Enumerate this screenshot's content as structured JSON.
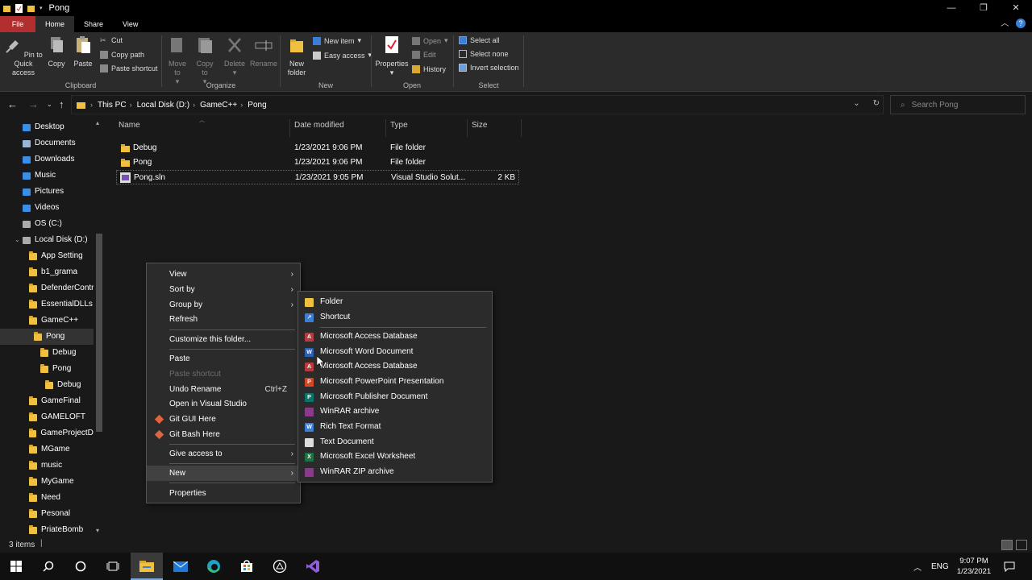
{
  "window": {
    "title": "Pong"
  },
  "tabs": {
    "file": "File",
    "home": "Home",
    "share": "Share",
    "view": "View"
  },
  "ribbon": {
    "clipboard": {
      "label": "Clipboard",
      "pin": "Pin to Quick access",
      "copy": "Copy",
      "paste": "Paste",
      "cut": "Cut",
      "copy_path": "Copy path",
      "paste_shortcut": "Paste shortcut"
    },
    "organize": {
      "label": "Organize",
      "move_to": "Move to",
      "copy_to": "Copy to",
      "delete": "Delete",
      "rename": "Rename"
    },
    "new": {
      "label": "New",
      "new_folder": "New folder",
      "new_item": "New item",
      "easy_access": "Easy access"
    },
    "open": {
      "label": "Open",
      "properties": "Properties",
      "open": "Open",
      "edit": "Edit",
      "history": "History"
    },
    "select": {
      "label": "Select",
      "select_all": "Select all",
      "select_none": "Select none",
      "invert": "Invert selection"
    }
  },
  "address": {
    "crumbs": [
      "This PC",
      "Local Disk (D:)",
      "GameC++",
      "Pong"
    ],
    "search_placeholder": "Search Pong"
  },
  "nav": {
    "items": [
      "Desktop",
      "Documents",
      "Downloads",
      "Music",
      "Pictures",
      "Videos",
      "OS (C:)",
      "Local Disk (D:)",
      "App Setting",
      "b1_grama",
      "DefenderContr",
      "EssentialDLLs",
      "GameC++",
      "Pong",
      "Debug",
      "Pong",
      "Debug",
      "GameFinal",
      "GAMELOFT",
      "GameProjectDc",
      "MGame",
      "music",
      "MyGame",
      "Need",
      "Pesonal",
      "PriateBomb"
    ]
  },
  "files": {
    "headers": {
      "name": "Name",
      "date": "Date modified",
      "type": "Type",
      "size": "Size"
    },
    "rows": [
      {
        "name": "Debug",
        "date": "1/23/2021 9:06 PM",
        "type": "File folder",
        "size": ""
      },
      {
        "name": "Pong",
        "date": "1/23/2021 9:06 PM",
        "type": "File folder",
        "size": ""
      },
      {
        "name": "Pong.sln",
        "date": "1/23/2021 9:05 PM",
        "type": "Visual Studio Solut...",
        "size": "2 KB"
      }
    ]
  },
  "context_menu": {
    "view": "View",
    "sort_by": "Sort by",
    "group_by": "Group by",
    "refresh": "Refresh",
    "customize": "Customize this folder...",
    "paste": "Paste",
    "paste_shortcut": "Paste shortcut",
    "undo_rename": "Undo Rename",
    "undo_shortcut": "Ctrl+Z",
    "open_vs": "Open in Visual Studio",
    "git_gui": "Git GUI Here",
    "git_bash": "Git Bash Here",
    "give_access": "Give access to",
    "new": "New",
    "properties": "Properties"
  },
  "new_submenu": {
    "items": [
      "Folder",
      "Shortcut",
      "Microsoft Access Database",
      "Microsoft Word Document",
      "Microsoft Access Database",
      "Microsoft PowerPoint Presentation",
      "Microsoft Publisher Document",
      "WinRAR archive",
      "Rich Text Format",
      "Text Document",
      "Microsoft Excel Worksheet",
      "WinRAR ZIP archive"
    ]
  },
  "status": {
    "count": "3 items"
  },
  "taskbar": {
    "lang": "ENG",
    "time": "9:07 PM",
    "date": "1/23/2021"
  },
  "colors": {
    "file_tab": "#b32f2f",
    "folder": "#f0c040",
    "background": "#191919",
    "menu": "#2b2b2b"
  }
}
